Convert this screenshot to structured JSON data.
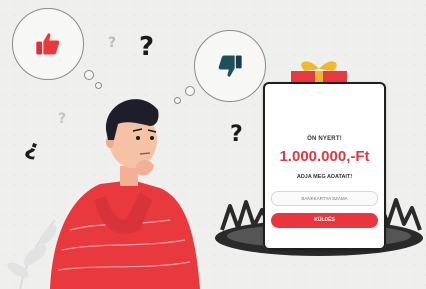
{
  "card": {
    "title": "ÖN NYERT!",
    "amount": "1.000.000,-Ft",
    "subtitle": "ADJA MEG ADATAIT!",
    "input_placeholder": "BANKKÁRTYA SZÁMA",
    "button_label": "KÜLDÉS"
  },
  "icons": {
    "like": "thumbs-up-icon",
    "dislike": "thumbs-down-icon",
    "gift": "gift-box-icon",
    "trap": "bear-trap-icon"
  },
  "question_marks": [
    "?",
    "?",
    "?",
    "?",
    "?"
  ],
  "colors": {
    "accent_red": "#ea343e",
    "dislike_teal": "#1e4f5c",
    "gift_ribbon": "#f2b72c",
    "shirt": "#e8393f",
    "background": "#efefee"
  }
}
